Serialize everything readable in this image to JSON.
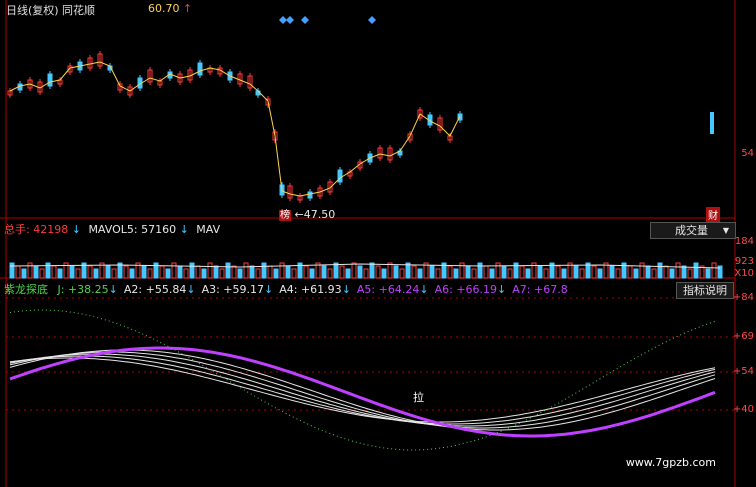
{
  "header": {
    "period": "日线(复权)",
    "stock_name": "同花顺",
    "price": "60.70",
    "price_arrow": "↑"
  },
  "price_chart": {
    "low_marker_label": "←47.50",
    "tag_bang": "榜",
    "tag_cai": "财",
    "axis_value": "54"
  },
  "volume_panel": {
    "total_label": "总手:",
    "total_value": "42198",
    "total_arrow": "↓",
    "mavol5_label": "MAVOL5:",
    "mavol5_value": "57160",
    "mavol5_arrow": "↓",
    "mav_truncated": "MAV",
    "button_label": "成交量",
    "dropdown_arrow": "▼",
    "axis_top": "184",
    "axis_mid": "923",
    "axis_unit": "X10"
  },
  "indicator_panel": {
    "name": "紫龙探底",
    "lines": [
      {
        "label": "J:",
        "value": "+38.25",
        "arrow": "↓",
        "color": "#4fd34f"
      },
      {
        "label": "A2:",
        "value": "+55.84",
        "arrow": "↓",
        "color": "#e6e6e6"
      },
      {
        "label": "A3:",
        "value": "+59.17",
        "arrow": "↓",
        "color": "#e6e6e6"
      },
      {
        "label": "A4:",
        "value": "+61.93",
        "arrow": "↓",
        "color": "#e6e6e6"
      },
      {
        "label": "A5:",
        "value": "+64.24",
        "arrow": "↓",
        "color": "#c040ff"
      },
      {
        "label": "A6:",
        "value": "+66.19",
        "arrow": "↓",
        "color": "#c040ff"
      },
      {
        "label": "A7:",
        "value": "+67.8",
        "arrow": "",
        "color": "#c040ff"
      }
    ],
    "button_label": "指标说明",
    "axis_labels": [
      "+84",
      "+69",
      "+54",
      "+40"
    ],
    "annotation": "拉"
  },
  "watermark": "www.7gpzb.com",
  "colors": {
    "up": "#ff3b3b",
    "down": "#46c8ff",
    "ma": "#ffd24a",
    "kdj_j": "#4fd34f",
    "purple": "#c040ff",
    "white_lines": "#e6e6e6"
  }
}
